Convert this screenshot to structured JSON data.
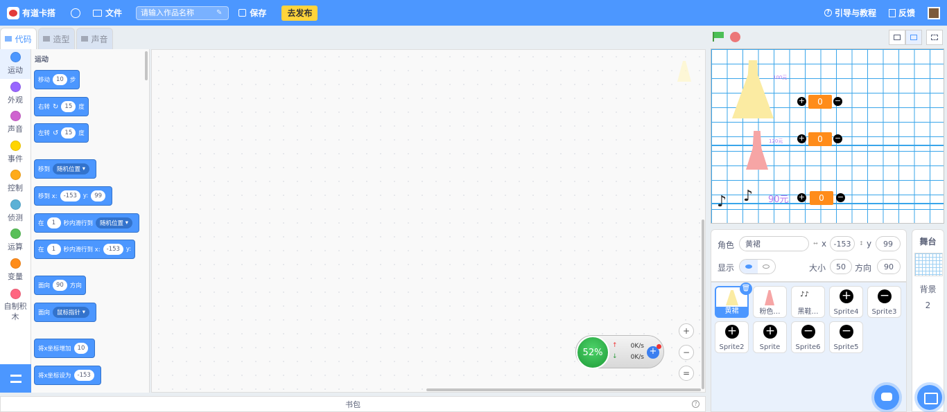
{
  "topbar": {
    "brand": "有道卡搭",
    "file_menu": "文件",
    "title_placeholder": "请输入作品名称",
    "save_label": "保存",
    "publish_label": "去发布",
    "guide_label": "引导与教程",
    "feedback_label": "反馈"
  },
  "tabs": [
    {
      "label": "代码",
      "active": true
    },
    {
      "label": "造型",
      "active": false
    },
    {
      "label": "声音",
      "active": false
    }
  ],
  "categories": [
    {
      "label": "运动",
      "color": "#4c97ff"
    },
    {
      "label": "外观",
      "color": "#9966ff"
    },
    {
      "label": "声音",
      "color": "#cf63cf"
    },
    {
      "label": "事件",
      "color": "#ffd500"
    },
    {
      "label": "控制",
      "color": "#ffab19"
    },
    {
      "label": "侦测",
      "color": "#5cb1d6"
    },
    {
      "label": "运算",
      "color": "#59c059"
    },
    {
      "label": "变量",
      "color": "#ff8c1a"
    },
    {
      "label": "自制积木",
      "color": "#ff6680"
    }
  ],
  "palette": {
    "section_title": "运动",
    "move": {
      "label": "移动",
      "steps": "10",
      "unit": "步"
    },
    "turn_right": {
      "label": "右转",
      "degrees": "15",
      "unit": "度"
    },
    "turn_left": {
      "label": "左转",
      "degrees": "15",
      "unit": "度"
    },
    "goto": {
      "label": "移到",
      "target": "随机位置"
    },
    "goto_xy": {
      "label": "移到 x:",
      "x": "-153",
      "y_label": "y:",
      "y": "99"
    },
    "glide": {
      "label_in": "在",
      "secs": "1",
      "label_to": "秒内滑行到",
      "target": "随机位置"
    },
    "glide_xy": {
      "label_in": "在",
      "secs": "1",
      "label_to": "秒内滑行到 x:",
      "x": "-153",
      "y_label": "y:"
    },
    "point_dir": {
      "label": "面向",
      "value": "90",
      "unit": "方向"
    },
    "point_towards": {
      "label": "面向",
      "target": "鼠标指针"
    },
    "change_x": {
      "label": "将x坐标增加",
      "value": "10"
    },
    "set_x": {
      "label": "将x坐标设为",
      "value": "-153"
    }
  },
  "speed_widget": {
    "percent": "52%",
    "upload": "0K/s",
    "download": "0K/s"
  },
  "backpack_label": "书包",
  "stage": {
    "price_100": "100元",
    "price_120": "120元",
    "price_90": "90元",
    "counters": [
      "0",
      "0",
      "0"
    ]
  },
  "sprite_info": {
    "sprite_label": "角色",
    "sprite_name": "黄裙",
    "x_label": "x",
    "x": "-153",
    "y_label": "y",
    "y": "99",
    "show_label": "显示",
    "size_label": "大小",
    "size": "50",
    "direction_label": "方向",
    "direction": "90"
  },
  "sprites": [
    {
      "name": "黄裙",
      "active": true,
      "thumb": "yellow"
    },
    {
      "name": "粉色…",
      "active": false,
      "thumb": "pink"
    },
    {
      "name": "黑鞋…",
      "active": false,
      "thumb": "shoe"
    },
    {
      "name": "Sprite4",
      "active": false,
      "thumb": "plus"
    },
    {
      "name": "Sprite3",
      "active": false,
      "thumb": "minus"
    },
    {
      "name": "Sprite2",
      "active": false,
      "thumb": "plus"
    },
    {
      "name": "Sprite",
      "active": false,
      "thumb": "plus"
    },
    {
      "name": "Sprite6",
      "active": false,
      "thumb": "minus"
    },
    {
      "name": "Sprite5",
      "active": false,
      "thumb": "minus"
    }
  ],
  "stage_panel": {
    "title": "舞台",
    "backdrop_label": "背景",
    "backdrop_count": "2"
  }
}
